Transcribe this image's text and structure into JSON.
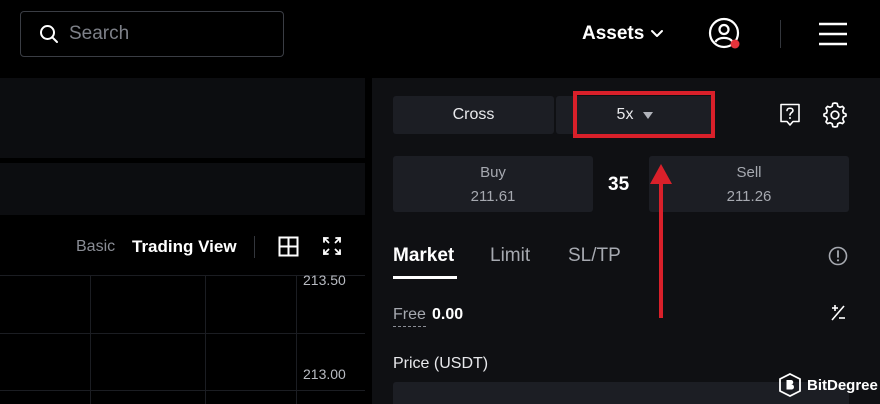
{
  "header": {
    "search_placeholder": "Search",
    "assets_label": "Assets",
    "icons": [
      "search-icon",
      "chevron-down-icon",
      "user-avatar-icon",
      "hamburger-menu-icon"
    ],
    "notification_dot_color": "#e5333b"
  },
  "chart": {
    "view_basic": "Basic",
    "view_trading": "Trading View",
    "price_ticks": [
      "213.50",
      "213.00"
    ],
    "icons": [
      "grid-layout-icon",
      "fullscreen-icon"
    ]
  },
  "trade": {
    "margin_mode": "Cross",
    "leverage": "5x",
    "buy_label": "Buy",
    "buy_price": "211.61",
    "spread": "35",
    "sell_label": "Sell",
    "sell_price": "211.26",
    "tabs": [
      {
        "label": "Market",
        "active": true
      },
      {
        "label": "Limit",
        "active": false
      },
      {
        "label": "SL/TP",
        "active": false
      }
    ],
    "free_label": "Free",
    "free_value": "0.00",
    "price_label": "Price (USDT)",
    "icons": [
      "help-icon",
      "gear-icon",
      "info-icon",
      "percent-icon"
    ]
  },
  "annotation": {
    "highlight_color": "#d9202a"
  },
  "watermark": {
    "text": "BitDegree"
  }
}
